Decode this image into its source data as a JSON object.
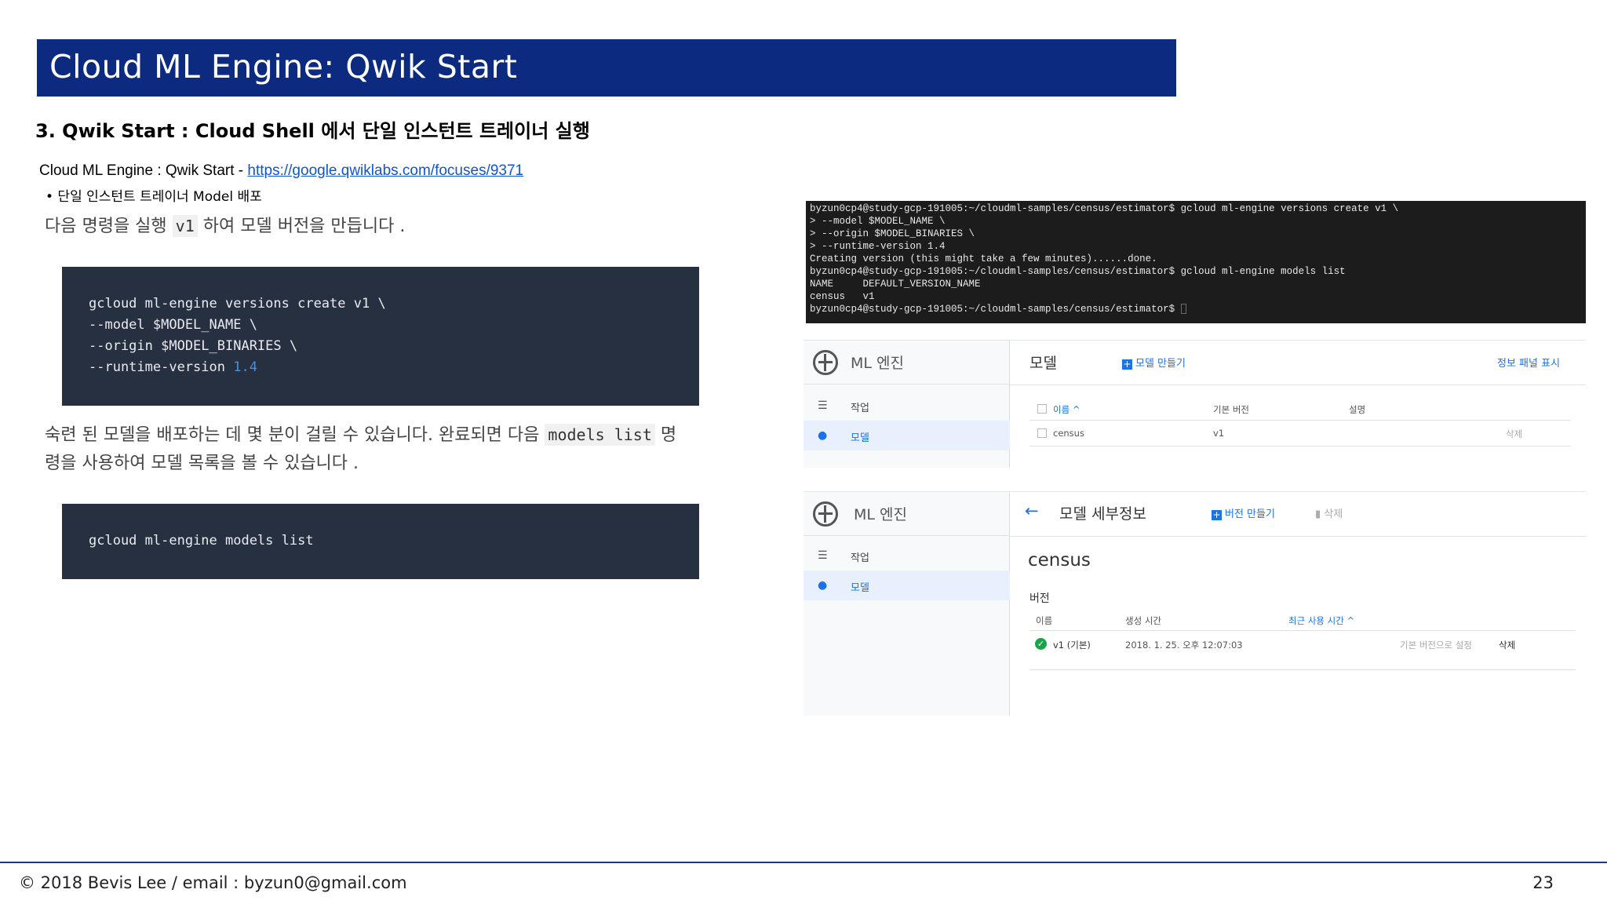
{
  "slide": {
    "title": "Cloud ML Engine: Qwik Start",
    "subtitle": "3. Qwik Start : Cloud Shell 에서 단일 인스턴트 트레이너 실행",
    "link_prefix": "Cloud ML Engine : Qwik Start - ",
    "link_text": "https://google.qwiklabs.com/focuses/9371",
    "bullet": "• 단일 인스턴트 트레이너 Model 배포",
    "para1_a": "다음 명령을 실행 ",
    "para1_code": "v1",
    "para1_b": " 하여 모델 버전을 만듭니다 .",
    "code1": {
      "line1": "gcloud ml-engine versions create v1 \\",
      "line2": "--model $MODEL_NAME \\",
      "line3": "--origin $MODEL_BINARIES \\",
      "line4_a": "--runtime-version ",
      "line4_num": "1.4"
    },
    "para2_a": "숙련 된 모델을 배포하는 데 몇 분이 걸릴 수 있습니다. 완료되면 다음 ",
    "para2_code": "models list",
    "para2_b": " 명",
    "para2_line2": "령을 사용하여 모델 목록을 볼 수 있습니다 .",
    "code2": "gcloud ml-engine models list",
    "footer": "© 2018 Bevis Lee  / email : byzun0@gmail.com",
    "page_number": "23"
  },
  "terminal": {
    "lines": [
      "byzun0cp4@study-gcp-191005:~/cloudml-samples/census/estimator$ gcloud ml-engine versions create v1 \\",
      "> --model $MODEL_NAME \\",
      "> --origin $MODEL_BINARIES \\",
      "> --runtime-version 1.4",
      "Creating version (this might take a few minutes)......done.",
      "byzun0cp4@study-gcp-191005:~/cloudml-samples/census/estimator$ gcloud ml-engine models list",
      "NAME     DEFAULT_VERSION_NAME",
      "census   v1",
      "byzun0cp4@study-gcp-191005:~/cloudml-samples/census/estimator$ "
    ]
  },
  "models_panel": {
    "app_title": "ML 엔진",
    "nav_jobs": "작업",
    "nav_models": "모델",
    "page_title": "모델",
    "create_model": "모델 만들기",
    "info_panel": "정보 패널 표시",
    "col_name": "이름 ^",
    "col_default_version": "기본 버전",
    "col_description": "설명",
    "row_name": "census",
    "row_version": "v1",
    "row_delete": "삭제"
  },
  "detail_panel": {
    "app_title": "ML 엔진",
    "nav_jobs": "작업",
    "nav_models": "모델",
    "back_arrow": "←",
    "page_title": "모델 세부정보",
    "create_version": "버전 만들기",
    "delete": "삭제",
    "model_name": "census",
    "versions_label": "버전",
    "col_name": "이름",
    "col_created": "생성 시간",
    "col_last_used": "최근 사용 시간 ^",
    "row_name": "v1 (기본)",
    "row_created": "2018. 1. 25. 오후 12:07:03",
    "row_set_default": "기본 버전으로 설정",
    "row_delete": "삭제"
  },
  "colors": {
    "title_bar": "#0b2a80",
    "code_bg": "#263040",
    "accent_blue": "#1a73e8",
    "ok_green": "#18a44a"
  }
}
